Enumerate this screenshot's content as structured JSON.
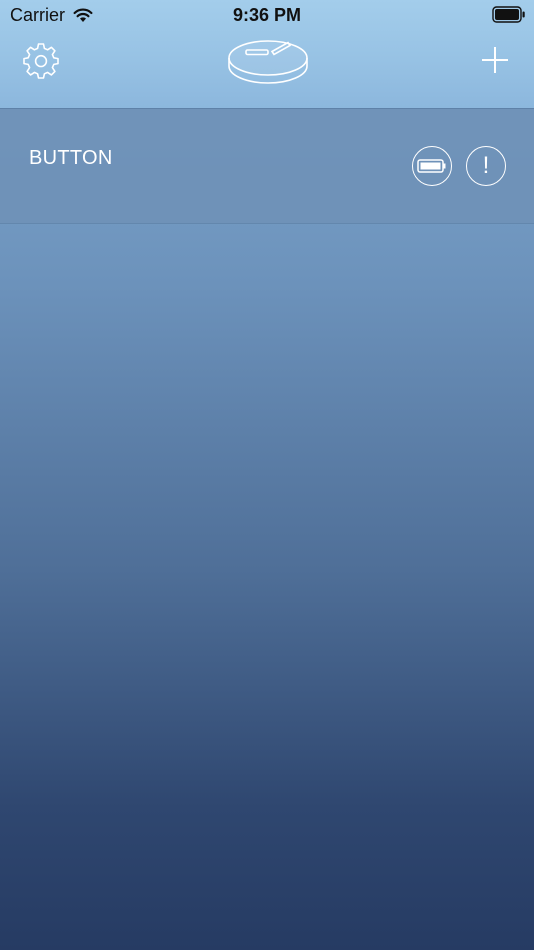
{
  "status_bar": {
    "carrier": "Carrier",
    "time": "9:36 PM",
    "icons": [
      "wifi-icon",
      "battery-icon"
    ]
  },
  "nav": {
    "settings_icon": "gear-icon",
    "logo_icon": "button-device-logo",
    "add_icon": "plus-icon"
  },
  "device": {
    "name": "BUTTON",
    "battery_icon": "battery-icon",
    "alert_glyph": "!"
  },
  "colors": {
    "top_bar": "#97c2e4",
    "row": "#6e91b6",
    "background_top": "#82acd2",
    "background_bottom": "#263b63",
    "foreground": "#ffffff"
  }
}
